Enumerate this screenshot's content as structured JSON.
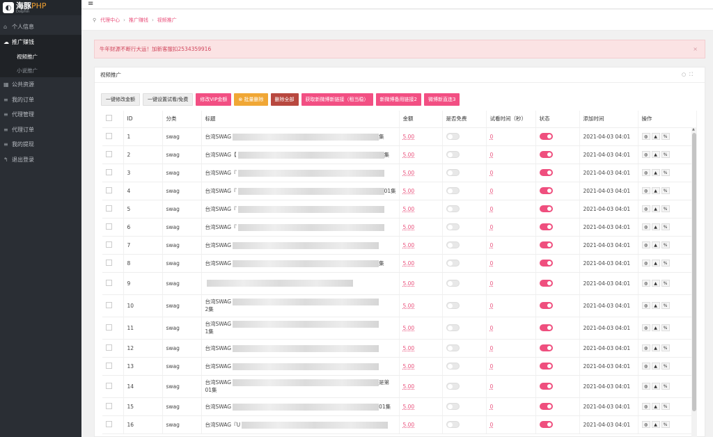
{
  "logo": {
    "name": "海豚",
    "php": "PHP",
    "sub": "Dolphin"
  },
  "sidebar": {
    "items": [
      {
        "label": "个人信息",
        "icon": "home-icon",
        "glyph": "⌂"
      },
      {
        "label": "推广赚钱",
        "icon": "cloud-icon",
        "glyph": "☁",
        "active": true
      },
      {
        "label": "公共资源",
        "icon": "grid-icon",
        "glyph": "▦"
      },
      {
        "label": "我的订单",
        "icon": "list-icon",
        "glyph": "≡"
      },
      {
        "label": "代理管理",
        "icon": "list-icon",
        "glyph": "≡"
      },
      {
        "label": "代理订单",
        "icon": "list-icon",
        "glyph": "≡"
      },
      {
        "label": "我的提现",
        "icon": "list-icon",
        "glyph": "≡"
      },
      {
        "label": "退出登录",
        "icon": "logout-icon",
        "glyph": "↰"
      }
    ],
    "subitems": [
      {
        "label": "视频推广",
        "active": true
      },
      {
        "label": "小说推广"
      }
    ]
  },
  "breadcrumb": [
    "代理中心",
    "推广赚钱",
    "视频推广"
  ],
  "alert": {
    "text": "牛年财源不断行大运！加新客服扣2534359916",
    "close": "×"
  },
  "panel": {
    "title": "视频推广"
  },
  "toolbar": [
    {
      "label": "一键修改金额",
      "style": "gray"
    },
    {
      "label": "一键设置试看/免费",
      "style": "gray"
    },
    {
      "label": "修改VIP金额",
      "style": "pink"
    },
    {
      "label": "⊗ 批量删除",
      "style": "orange"
    },
    {
      "label": "删除全部",
      "style": "brown"
    },
    {
      "label": "获取新微博新链接（租当稳）",
      "style": "pink"
    },
    {
      "label": "新微博备用链接2",
      "style": "pink"
    },
    {
      "label": "微博新直连3",
      "style": "pink"
    }
  ],
  "table": {
    "headers": [
      "",
      "ID",
      "分类",
      "标题",
      "金额",
      "是否免费",
      "试看时间（秒）",
      "状态",
      "添加时间",
      "操作"
    ],
    "rows": [
      {
        "id": "1",
        "cat": "swag",
        "title": "台湾SWAG",
        "tail": "集",
        "amount": "5.00",
        "trial": "0",
        "time": "2021-04-03 04:01"
      },
      {
        "id": "2",
        "cat": "swag",
        "title": "台湾SWAG【",
        "tail": "集",
        "amount": "5.00",
        "trial": "0",
        "time": "2021-04-03 04:01"
      },
      {
        "id": "3",
        "cat": "swag",
        "title": "台湾SWAG『",
        "tail": "",
        "amount": "5.00",
        "trial": "0",
        "time": "2021-04-03 04:01"
      },
      {
        "id": "4",
        "cat": "swag",
        "title": "台湾SWAG『",
        "tail": "01集",
        "amount": "5.00",
        "trial": "0",
        "time": "2021-04-03 04:01"
      },
      {
        "id": "5",
        "cat": "swag",
        "title": "台湾SWAG『",
        "tail": "",
        "amount": "5.00",
        "trial": "0",
        "time": "2021-04-03 04:01"
      },
      {
        "id": "6",
        "cat": "swag",
        "title": "台湾SWAG『",
        "tail": "",
        "amount": "5.00",
        "trial": "0",
        "time": "2021-04-03 04:01"
      },
      {
        "id": "7",
        "cat": "swag",
        "title": "台湾SWAG",
        "tail": "",
        "amount": "5.00",
        "trial": "0",
        "time": "2021-04-03 04:01"
      },
      {
        "id": "8",
        "cat": "swag",
        "title": "台湾SWAG",
        "tail": "集",
        "amount": "5.00",
        "trial": "0",
        "time": "2021-04-03 04:01"
      },
      {
        "id": "9",
        "cat": "swag",
        "title": "",
        "tail": "",
        "amount": "5.00",
        "trial": "0",
        "time": "2021-04-03 04:01",
        "tall": true
      },
      {
        "id": "10",
        "cat": "swag",
        "title": "台湾SWAG",
        "line2": "2集",
        "tail": "",
        "amount": "5.00",
        "trial": "0",
        "time": "2021-04-03 04:01",
        "tall": true
      },
      {
        "id": "11",
        "cat": "swag",
        "title": "台湾SWAG",
        "line2": "1集",
        "tail": "",
        "amount": "5.00",
        "trial": "0",
        "time": "2021-04-03 04:01",
        "tall": true
      },
      {
        "id": "12",
        "cat": "swag",
        "title": "台湾SWAG",
        "tail": "",
        "amount": "5.00",
        "trial": "0",
        "time": "2021-04-03 04:01"
      },
      {
        "id": "13",
        "cat": "swag",
        "title": "台湾SWAG",
        "tail": "",
        "amount": "5.00",
        "trial": "0",
        "time": "2021-04-03 04:01"
      },
      {
        "id": "14",
        "cat": "swag",
        "title": "台湾SWAG",
        "line2": "01集",
        "tail": "是第",
        "amount": "5.00",
        "trial": "0",
        "time": "2021-04-03 04:01",
        "tall": true
      },
      {
        "id": "15",
        "cat": "swag",
        "title": "台湾SWAG",
        "tail": "01集",
        "amount": "5.00",
        "trial": "0",
        "time": "2021-04-03 04:01"
      },
      {
        "id": "16",
        "cat": "swag",
        "title": "台湾SWAG『U",
        "tail": "",
        "amount": "5.00",
        "trial": "0",
        "time": "2021-04-03 04:01"
      }
    ]
  },
  "colors": {
    "accent": "#f24f83",
    "sidebar": "#2a2e34"
  }
}
